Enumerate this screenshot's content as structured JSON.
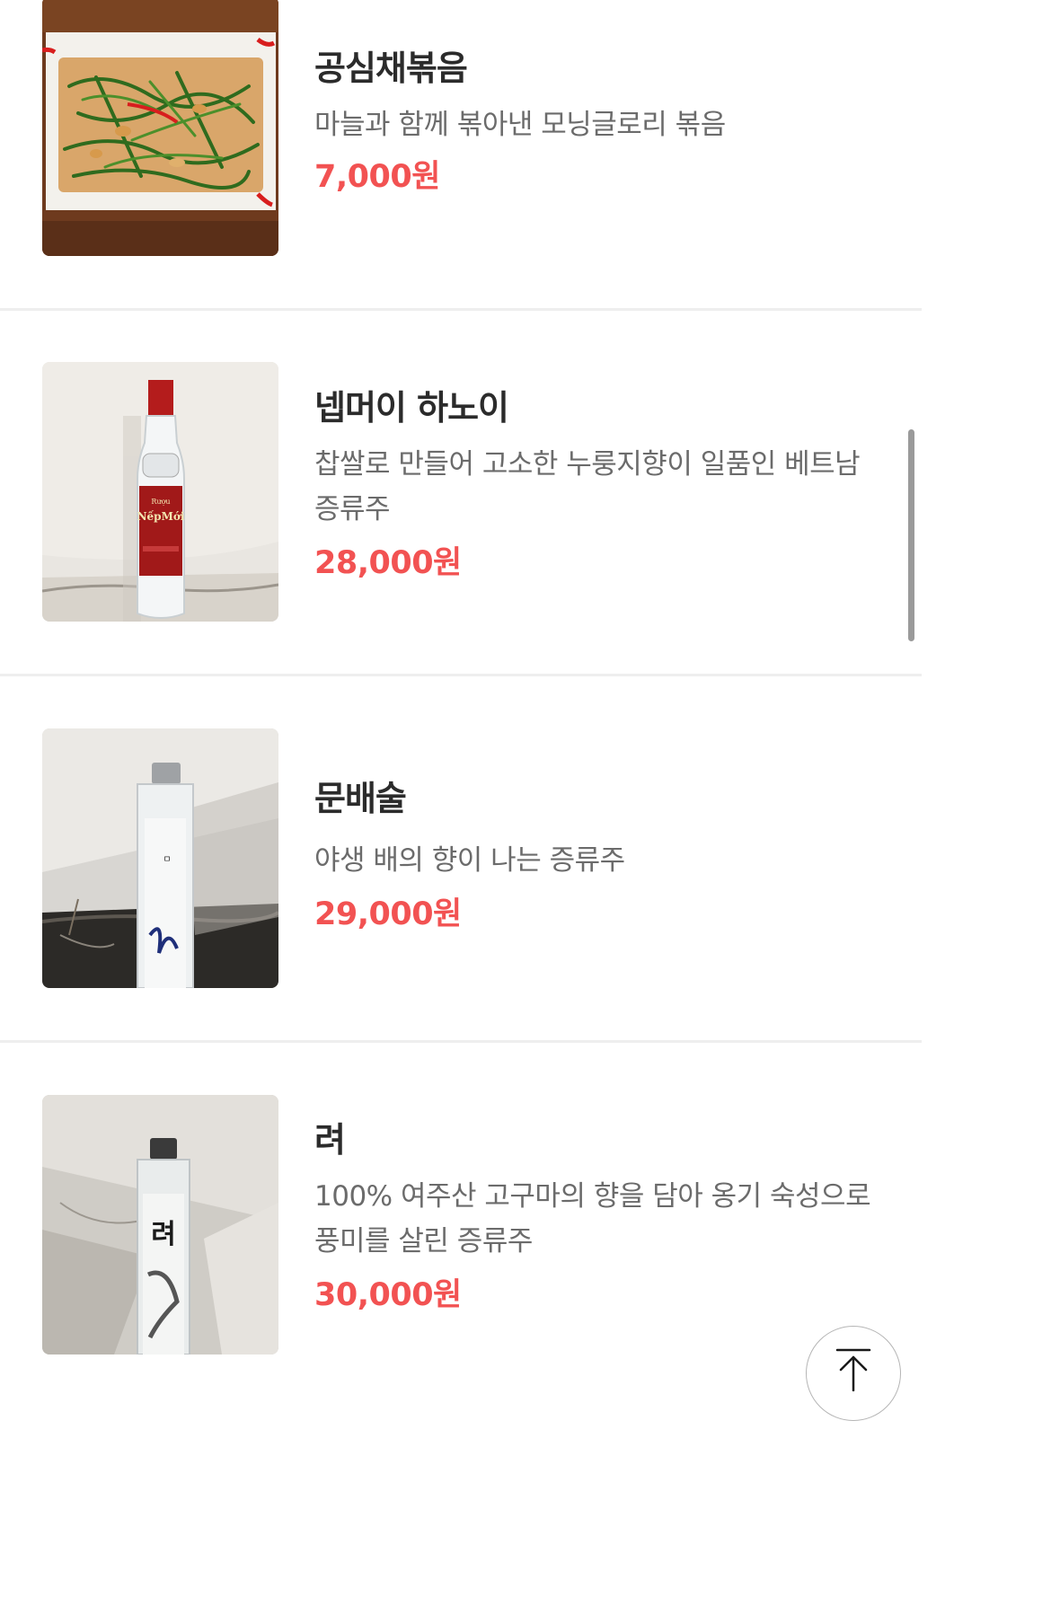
{
  "menu": [
    {
      "name": "공심채볶음",
      "description": "마늘과 함께 볶아낸 모닝글로리 볶음",
      "price": "7,000원"
    },
    {
      "name": "넵머이 하노이",
      "description": "찹쌀로 만들어 고소한 누룽지향이 일품인 베트남 증류주",
      "price": "28,000원"
    },
    {
      "name": "문배술",
      "description": "야생 배의 향이 나는 증류주",
      "price": "29,000원"
    },
    {
      "name": "려",
      "description": "100% 여주산 고구마의 향을 담아 옹기 숙성으로 풍미를 살린 증류주",
      "price": "30,000원"
    }
  ],
  "images": {
    "bottle1_label_top": "Rượu",
    "bottle1_label_main": "NếpMới",
    "bottle3_label": "려"
  },
  "icons": {
    "scroll_top": "arrow-up-to-top-icon"
  },
  "colors": {
    "price": "#f25252",
    "name": "#2b2b2b",
    "description": "#6b6b6b",
    "divider": "#eeeeee"
  }
}
